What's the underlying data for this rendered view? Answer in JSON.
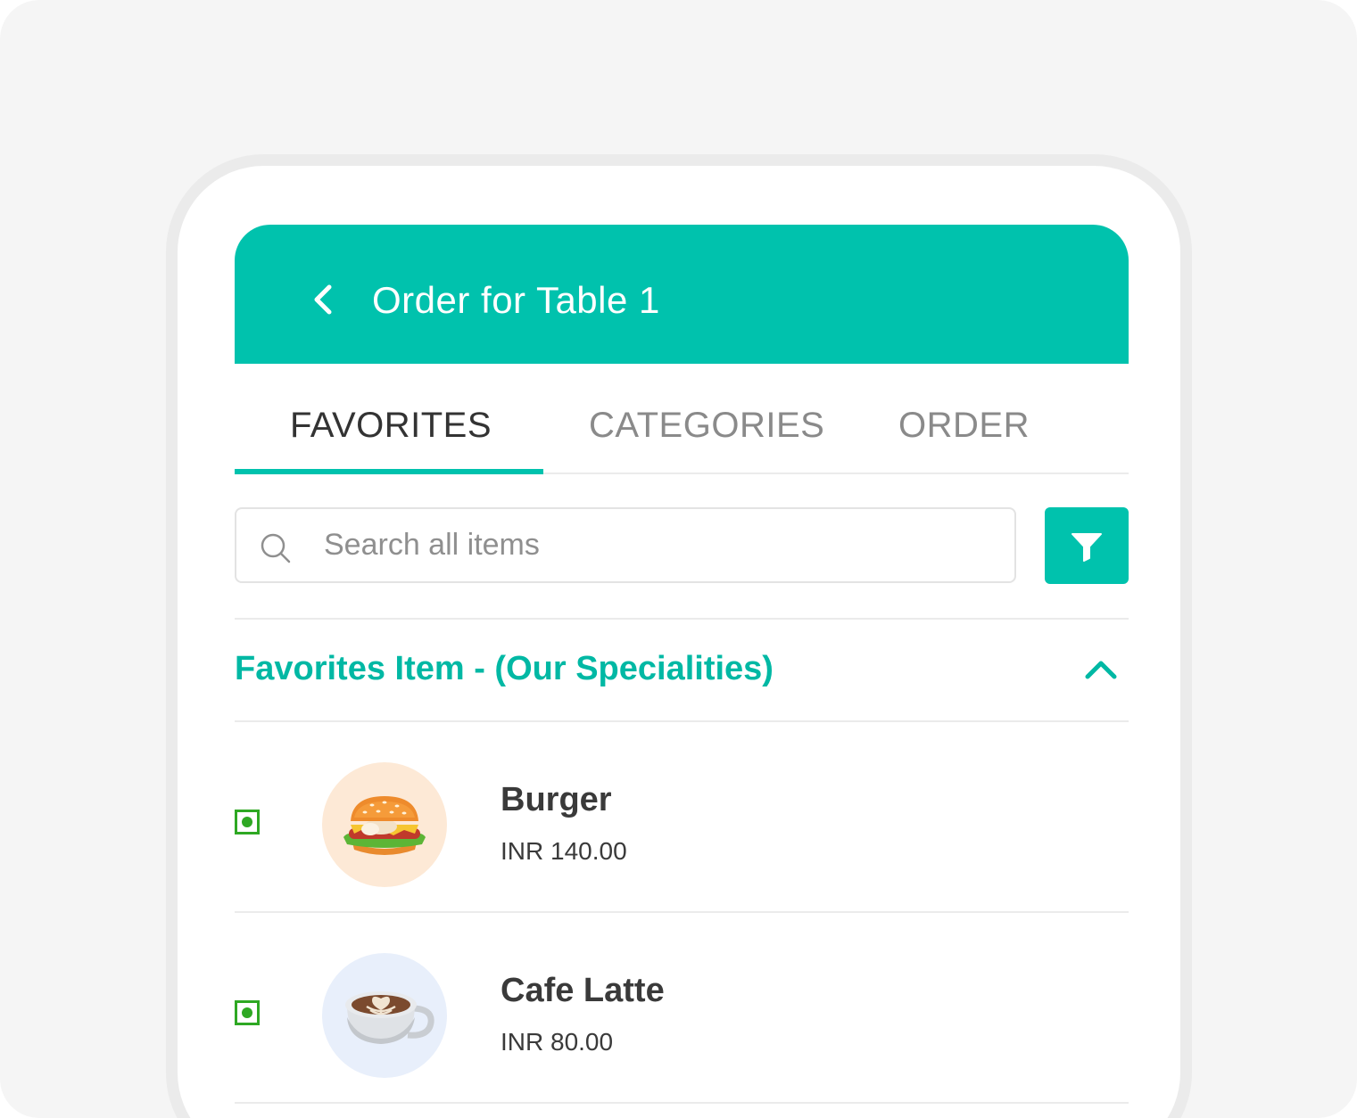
{
  "header": {
    "title": "Order for Table 1",
    "back_icon": "chevron-left-icon"
  },
  "tabs": [
    {
      "label": "FAVORITES",
      "active": true
    },
    {
      "label": "CATEGORIES",
      "active": false
    },
    {
      "label": "ORDER",
      "active": false
    }
  ],
  "search": {
    "placeholder": "Search all items",
    "value": "",
    "icon": "search-icon",
    "filter_icon": "filter-icon"
  },
  "section": {
    "title": "Favorites Item - (Our Specialities)",
    "expanded": true,
    "toggle_icon": "chevron-up-icon"
  },
  "items": [
    {
      "name": "Burger",
      "price": "INR 140.00",
      "veg": true,
      "icon": "burger-icon",
      "thumb_bg": "#fde9d6"
    },
    {
      "name": "Cafe Latte",
      "price": "INR 80.00",
      "veg": true,
      "icon": "coffee-cup-icon",
      "thumb_bg": "#e8effb"
    }
  ],
  "colors": {
    "accent": "#00c2ad",
    "veg_green": "#2ea823",
    "background": "#f5f5f5"
  }
}
